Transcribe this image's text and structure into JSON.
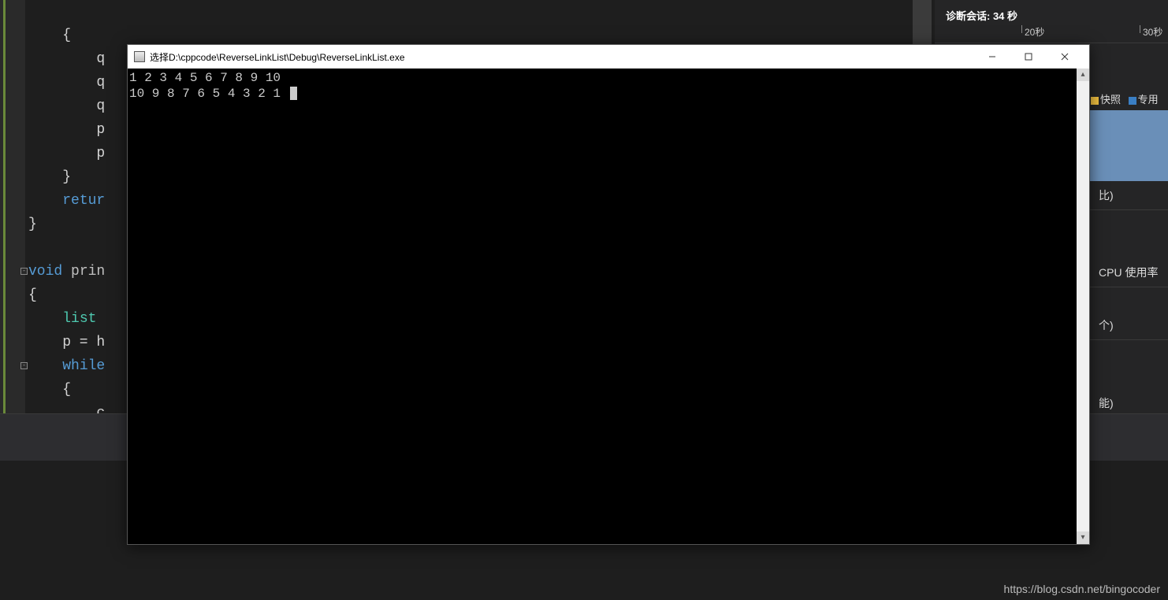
{
  "code": {
    "lines": [
      "",
      "    {",
      "        q",
      "        q",
      "        q",
      "        p",
      "        p",
      "    }",
      "    retur",
      "}",
      "",
      "void prin",
      "{",
      "    list",
      "    p = h",
      "    while",
      "    {",
      "        c"
    ],
    "tokens": {
      "kw_void": "void",
      "fn_prin": " prin",
      "kw_retur": "retur",
      "type_list": "list",
      "kw_while": "while"
    }
  },
  "diag": {
    "title": "诊断会话: 34 秒",
    "ticks": [
      {
        "label": "20秒",
        "pos": 110
      },
      {
        "label": "30秒",
        "pos": 260
      }
    ],
    "legend": {
      "snap": "快照",
      "private": "专用"
    },
    "legend_colors": {
      "snap": "#f0c040",
      "private": "#3a7fc4"
    },
    "sections": {
      "ratio": "比)",
      "cpu": "CPU 使用率",
      "count": "个)",
      "perf": "能)"
    }
  },
  "console": {
    "title": "选择D:\\cppcode\\ReverseLinkList\\Debug\\ReverseLinkList.exe",
    "output": [
      "1 2 3 4 5 6 7 8 9 10",
      "10 9 8 7 6 5 4 3 2 1"
    ]
  },
  "watermark": "https://blog.csdn.net/bingocoder"
}
